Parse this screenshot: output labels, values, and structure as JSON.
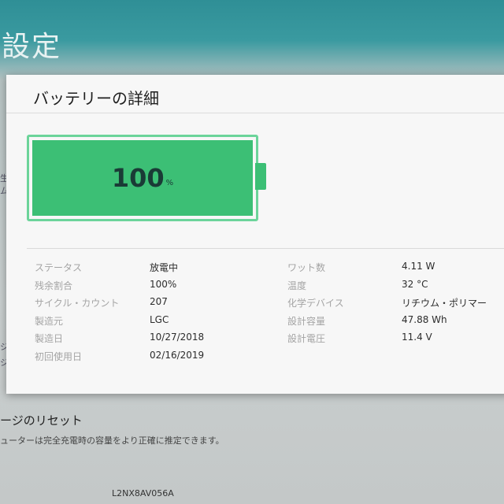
{
  "background": {
    "page_title": "設定",
    "edge_text": [
      "生",
      "ム",
      "ジ",
      "ジ"
    ],
    "reset_title": "ージのリセット",
    "reset_description": "ューターは完全充電時の容量をより正確に推定できます。",
    "serial": "L2NX8AV056A"
  },
  "dialog": {
    "title": "バッテリーの詳細"
  },
  "battery": {
    "charge_value": "100",
    "charge_unit": "%",
    "charge_percent": 100,
    "fill_color": "#3cbf75",
    "border_color": "#6cd49a"
  },
  "details_left": [
    {
      "label": "ステータス",
      "value": "放電中"
    },
    {
      "label": "残余割合",
      "value": "100%"
    },
    {
      "label": "サイクル・カウント",
      "value": "207"
    },
    {
      "label": "製造元",
      "value": "LGC"
    },
    {
      "label": "製造日",
      "value": "10/27/2018"
    },
    {
      "label": "初回使用日",
      "value": "02/16/2019"
    }
  ],
  "details_right": [
    {
      "label": "ワット数",
      "value": "4.11 W"
    },
    {
      "label": "温度",
      "value": "32 °C"
    },
    {
      "label": "化学デバイス",
      "value": "リチウム・ポリマー"
    },
    {
      "label": "設計容量",
      "value": "47.88 Wh"
    },
    {
      "label": "設計電圧",
      "value": "11.4 V"
    }
  ]
}
